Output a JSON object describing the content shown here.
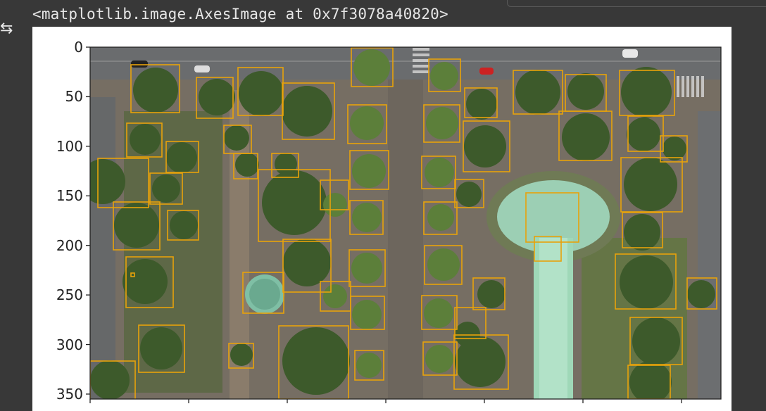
{
  "output": {
    "icon": "output-toggle-icon",
    "repr_text": "<matplotlib.image.AxesImage at 0x7f3078a40820>"
  },
  "chart_data": {
    "type": "image",
    "ylim": [
      355,
      0
    ],
    "yticks": [
      "0",
      "50",
      "100",
      "150",
      "200",
      "250",
      "300",
      "350"
    ],
    "xtick_count": 7,
    "box_color": "#e8a20a",
    "image_description_colors": {
      "road": "#6b6e70",
      "plaza": "#7a7266",
      "tree_dark": "#3f5a2c",
      "tree_light": "#66863d",
      "fountain": "#8ed3b4"
    },
    "box_count": 62
  }
}
